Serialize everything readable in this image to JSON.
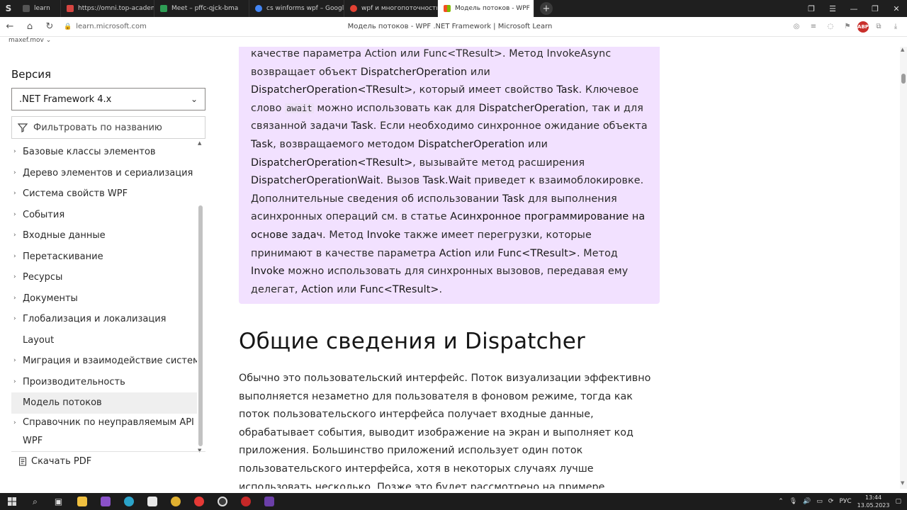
{
  "browser": {
    "tabs": [
      {
        "label": "learn",
        "active": false,
        "color": "#555555"
      },
      {
        "label": "https://omni.top-academy",
        "active": false,
        "color": "#d64541"
      },
      {
        "label": "Meet – pffc-qjck-bma",
        "active": false,
        "color": "#2e9e55"
      },
      {
        "label": "cs winforms wpf – Google",
        "active": false,
        "color": "#4285f4"
      },
      {
        "label": "wpf и многопоточность",
        "active": false,
        "color": "#e34133"
      },
      {
        "label": "Модель потоков - WPF",
        "active": true,
        "color": "#f25022"
      }
    ],
    "url": "learn.microsoft.com",
    "page_title": "Модель потоков - WPF .NET Framework | Microsoft Learn",
    "abp_label": "ABP"
  },
  "site_strip": "maxef.mov",
  "sidebar": {
    "version_label": "Версия",
    "version_value": ".NET Framework 4.x",
    "filter_placeholder": "Фильтровать по названию",
    "items": [
      {
        "label": "Базовые классы элементов",
        "expandable": true
      },
      {
        "label": "Дерево элементов и сериализация",
        "expandable": true
      },
      {
        "label": "Система свойств WPF",
        "expandable": true
      },
      {
        "label": "События",
        "expandable": true
      },
      {
        "label": "Входные данные",
        "expandable": true
      },
      {
        "label": "Перетаскивание",
        "expandable": true
      },
      {
        "label": "Ресурсы",
        "expandable": true
      },
      {
        "label": "Документы",
        "expandable": true
      },
      {
        "label": "Глобализация и локализация",
        "expandable": true
      },
      {
        "label": "Layout",
        "expandable": false
      },
      {
        "label": "Миграция и взаимодействие систем",
        "expandable": true
      },
      {
        "label": "Производительность",
        "expandable": true
      },
      {
        "label": "Модель потоков",
        "expandable": false,
        "selected": true
      },
      {
        "label": "Справочник по неуправляемым API WPF",
        "expandable": true
      }
    ],
    "download_pdf": "Скачать PDF"
  },
  "main": {
    "note": {
      "top_line": "качестве параметра Action или Func<TResult>. Метод InvokeAsync",
      "t1": "возвращает объект ",
      "b1": "DispatcherOperation",
      "t2": " или ",
      "b2": "DispatcherOperation<TResult>",
      "t3": ", который имеет свойство ",
      "b3": "Task",
      "t4": ". Ключевое слово ",
      "code1": "await",
      "t5": " можно использовать как для ",
      "b4": "DispatcherOperation",
      "t6": ", так и для связанной задачи ",
      "b5": "Task",
      "t7": ". Если необходимо синхронное ожидание объекта ",
      "b6": "Task",
      "t8": ", возвращаемого методом ",
      "b7": "DispatcherOperation",
      "t9": " или ",
      "b8": "DispatcherOperation<TResult>",
      "t10": ", вызывайте метод расширения ",
      "b9": "DispatcherOperationWait",
      "t11": ". Вызов ",
      "b10": "Task.Wait",
      "t12": " приведет к взаимоблокировке. Дополнительные сведения об использовании ",
      "b11": "Task",
      "t13": " для выполнения асинхронных операций см. в статье ",
      "b12": "Асинхронное программирование на основе задач",
      "t14": ". Метод ",
      "b13": "Invoke",
      "t15": " также имеет перегрузки, которые принимают в качестве параметра ",
      "b14": "Action",
      "t16": " или ",
      "b15": "Func<TResult>",
      "t17": ". Метод ",
      "b16": "Invoke",
      "t18": " можно использовать для синхронных вызовов, передавая ему делегат, ",
      "b17": "Action",
      "t19": " или ",
      "b18": "Func<TResult>",
      "t20": "."
    },
    "heading": "Общие сведения и Dispatcher",
    "paragraph": "Обычно это пользовательский интерфейс. Поток визуализации эффективно выполняется незаметно для пользователя в фоновом режиме, тогда как поток пользовательского интерфейса получает входные данные, обрабатывает события, выводит изображение на экран и выполняет код приложения. Большинство приложений использует один поток пользовательского интерфейса, хотя в некоторых случаях лучше использовать несколько. Позже это будет рассмотрено на примере."
  },
  "taskbar": {
    "lang": "РУС",
    "time": "13:44",
    "date": "13.05.2023"
  },
  "colors": {
    "note_bg": "#f2e1ff",
    "active_tab": "#ffffff",
    "taskbar": "#1c1c1c"
  }
}
